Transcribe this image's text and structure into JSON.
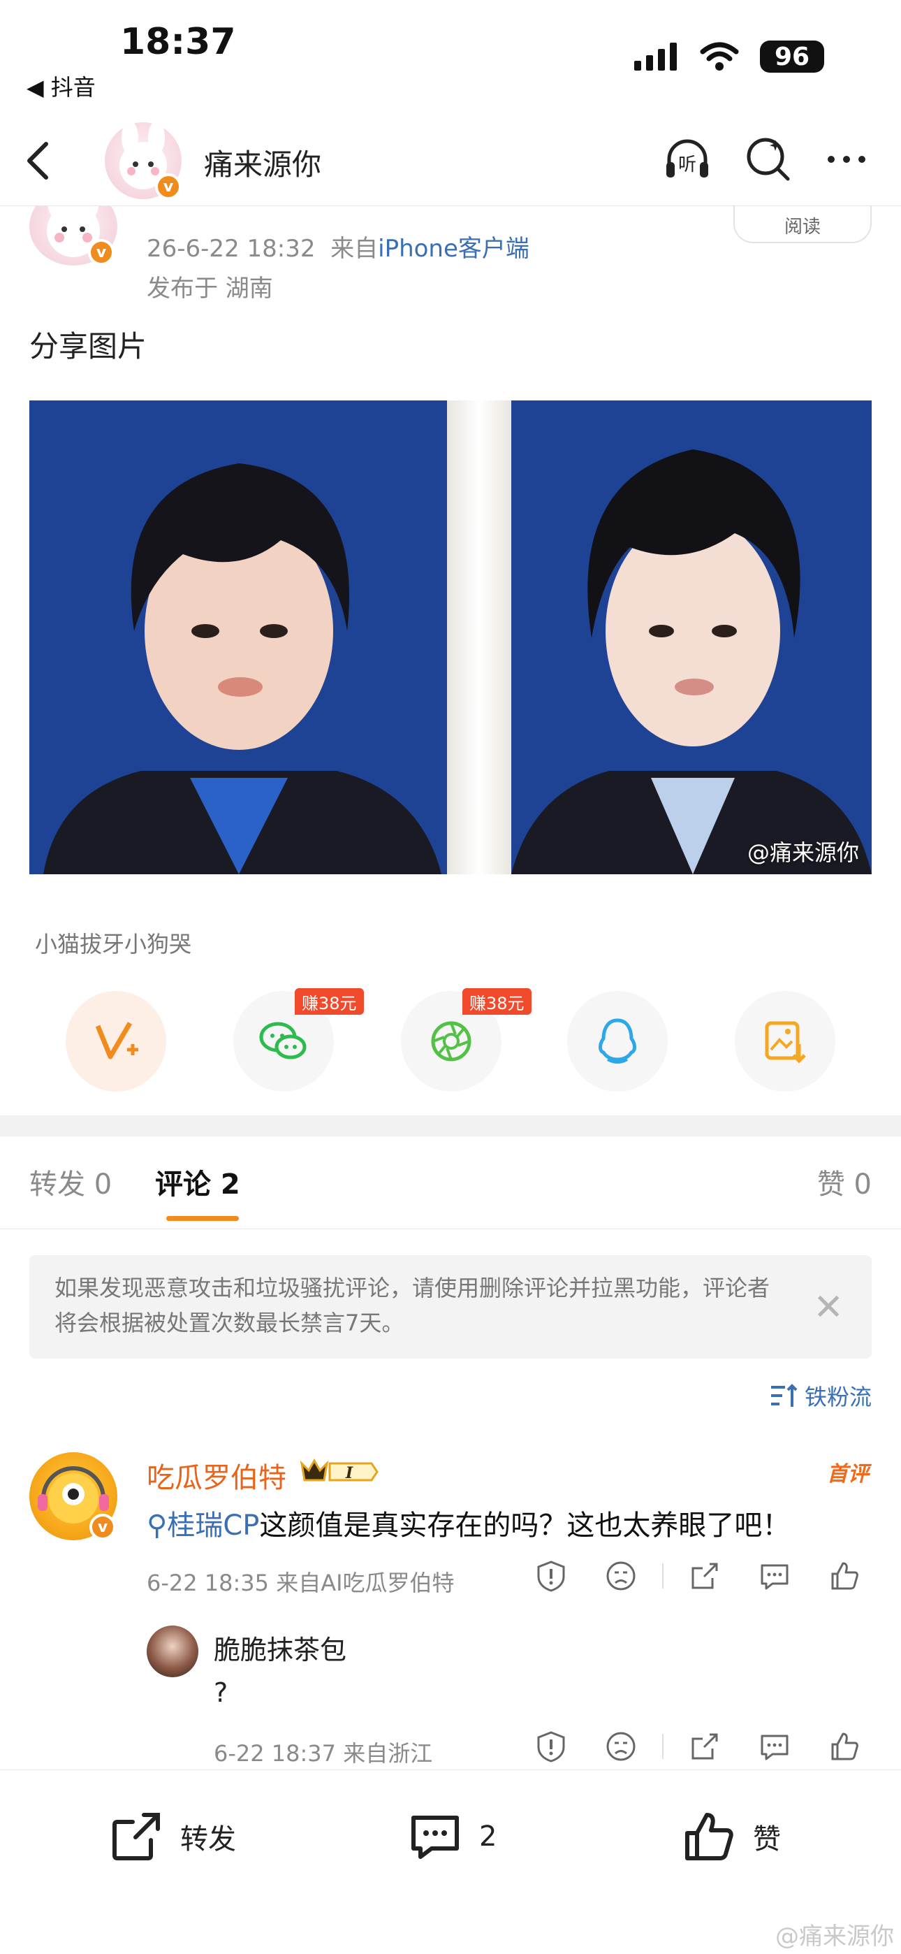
{
  "status_bar": {
    "time": "18:37",
    "back_app": "◀ 抖音",
    "battery": "96"
  },
  "nav": {
    "title": "痛来源你"
  },
  "post": {
    "time": "26-6-22 18:32",
    "source_prefix": "来自",
    "source": "iPhone客户端",
    "location": "发布于 湖南",
    "reads_label": "阅读",
    "text": "分享图片",
    "image_watermark": "@痛来源你",
    "tagline": "小猫拔牙小狗哭"
  },
  "share": {
    "earn_label": "赚38元"
  },
  "tabs": {
    "repost": "转发 0",
    "comments": "评论 2",
    "likes": "赞 0"
  },
  "notice": {
    "text": "如果发现恶意攻击和垃圾骚扰评论，请使用删除评论并拉黑功能，评论者将会根据被处置次数最长禁言7天。"
  },
  "sort": {
    "label": "铁粉流"
  },
  "comment": {
    "name": "吃瓜罗伯特",
    "badge": "I",
    "hot": "首评",
    "topic": "桂瑞CP",
    "text": "这颜值是真实存在的吗？这也太养眼了吧！",
    "meta": "6-22 18:35  来自AI吃瓜罗伯特"
  },
  "reply": {
    "name": "脆脆抹茶包",
    "text": "?",
    "meta": "6-22 18:37  来自浙江"
  },
  "bottom_bar": {
    "repost": "转发",
    "comments": "2",
    "like": "赞"
  },
  "page_watermark": "@痛来源你",
  "colors": {
    "accent_orange": "#f08b1e",
    "link_blue": "#3a6fb5",
    "earn_red": "#f04a2a"
  }
}
